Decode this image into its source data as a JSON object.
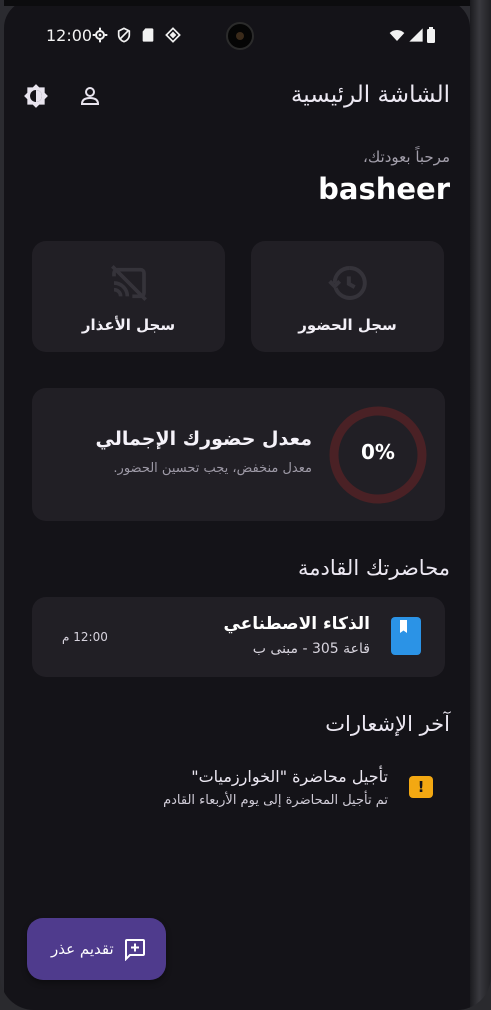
{
  "status_bar": {
    "time": "12:00",
    "icons": [
      "gear-icon",
      "shield-icon",
      "sd-card-icon",
      "vpn-icon",
      "wifi-icon",
      "signal-icon",
      "battery-icon"
    ]
  },
  "header": {
    "title": "الشاشة الرئيسية",
    "icons": [
      "theme-toggle-icon",
      "profile-icon"
    ]
  },
  "welcome": {
    "greeting": "مرحباً بعودتك،",
    "name": "basheer"
  },
  "actions": {
    "attendance_log": "سجل الحضور",
    "excuses_log": "سجل الأعذار"
  },
  "attendance": {
    "value": "0%",
    "rate": 0,
    "title": "معدل حضورك الإجمالي",
    "subtitle": "معدل منخفض، يجب تحسين الحضور.",
    "ring_color": "#4a2125"
  },
  "upcoming": {
    "section_title": "محاضرتك القادمة",
    "lecture": {
      "title": "الذكاء الاصطناعي",
      "room": "قاعة 305 - مبنى ب",
      "time": "12:00 م"
    }
  },
  "notifications": {
    "section_title": "آخر الإشعارات",
    "items": [
      {
        "title": "تأجيل محاضرة \"الخوارزميات\"",
        "body": "تم تأجيل المحاضرة إلى يوم الأربعاء القادم",
        "icon_glyph": "!"
      }
    ]
  },
  "fab": {
    "label": "تقديم عذر"
  },
  "colors": {
    "background": "#141318",
    "card": "#211f25",
    "accent": "#4f3b8d",
    "lecture_icon": "#2b93e6",
    "warning": "#f3a812"
  }
}
